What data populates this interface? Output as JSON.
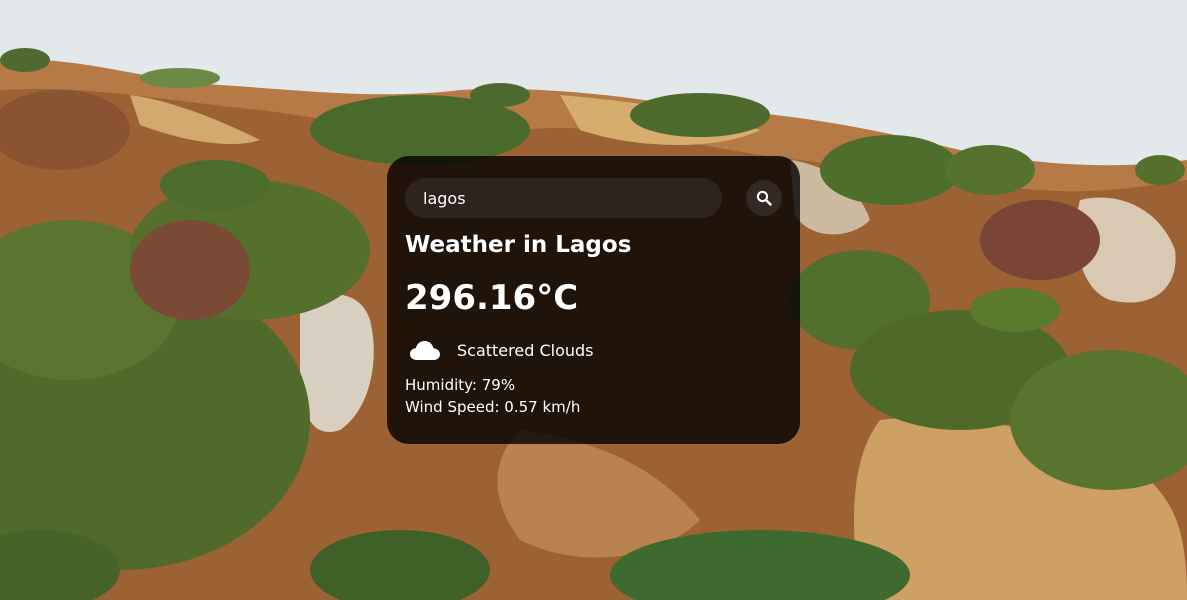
{
  "search": {
    "value": "lagos",
    "button_icon": "search-icon"
  },
  "weather": {
    "city_heading": "Weather in Lagos",
    "temperature": "296.16°C",
    "description": "Scattered Clouds",
    "condition_icon": "cloud-icon",
    "humidity": "Humidity: 79%",
    "wind": "Wind Speed: 0.57 km/h"
  },
  "colors": {
    "card_background": "#000000cc",
    "text": "#ffffff",
    "sky": "#e3e8ea"
  },
  "background": {
    "description_icon": "landscape-background"
  }
}
